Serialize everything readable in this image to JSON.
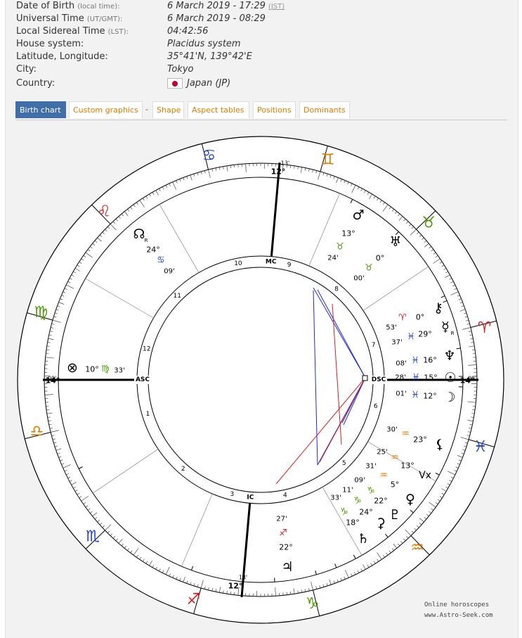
{
  "details": [
    {
      "label": "Date of Birth",
      "label_small": "(local time):",
      "value": "6 March 2019 - 17:29",
      "value_tz": "(JST)"
    },
    {
      "label": "Universal Time",
      "label_small": "(UT/GMT):",
      "value": "6 March 2019 - 08:29"
    },
    {
      "label": "Local Sidereal Time",
      "label_small": "(LST):",
      "value": "04:42:56"
    },
    {
      "label": "House system:",
      "value": "Placidus system"
    },
    {
      "label": "Latitude, Longitude:",
      "value": "35°41'N, 139°42'E"
    },
    {
      "label": "City:",
      "value": "Tokyo"
    },
    {
      "label": "Country:",
      "value": "Japan (JP)",
      "flag": "japan-flag"
    }
  ],
  "tabs": [
    {
      "label": "Birth chart",
      "active": true
    },
    {
      "label": "Custom graphics"
    },
    {
      "label": "Shape"
    },
    {
      "label": "Aspect tables"
    },
    {
      "label": "Positions"
    },
    {
      "label": "Dominants"
    }
  ],
  "tab_separator": "-",
  "chart": {
    "zodiac_signs": [
      {
        "glyph": "♊",
        "name": "gemini",
        "color": "#e07b00"
      },
      {
        "glyph": "♉",
        "name": "taurus",
        "color": "#4e9a06"
      },
      {
        "glyph": "♈",
        "name": "aries",
        "color": "#d61f1f"
      },
      {
        "glyph": "♓",
        "name": "pisces",
        "color": "#1f3fd6"
      },
      {
        "glyph": "♒",
        "name": "aquarius",
        "color": "#e07b00"
      },
      {
        "glyph": "♑",
        "name": "capricorn",
        "color": "#4e9a06"
      },
      {
        "glyph": "♐",
        "name": "sagittarius",
        "color": "#d61f1f"
      },
      {
        "glyph": "♏",
        "name": "scorpio",
        "color": "#1f3fd6"
      },
      {
        "glyph": "♎",
        "name": "libra",
        "color": "#e07b00"
      },
      {
        "glyph": "♍",
        "name": "virgo",
        "color": "#4e9a06"
      },
      {
        "glyph": "♌",
        "name": "leo",
        "color": "#d61f1f"
      },
      {
        "glyph": "♋",
        "name": "cancer",
        "color": "#1f3fd6"
      }
    ],
    "angles": {
      "asc": {
        "label": "ASC",
        "degree": "14°",
        "minute": "00'"
      },
      "dsc": {
        "label": "DSC",
        "degree": "14°",
        "minute": "00'"
      },
      "mc": {
        "label": "MC",
        "degree": "12°",
        "minute": "13'"
      },
      "ic": {
        "label": "IC",
        "degree": "12°",
        "minute": "13'"
      }
    },
    "house_numbers": [
      "1",
      "2",
      "3",
      "4",
      "5",
      "6",
      "7",
      "8",
      "9",
      "10",
      "11",
      "12"
    ],
    "planets": [
      {
        "name": "mars",
        "glyph": "♂",
        "degree": "13°",
        "sign_glyph": "♉",
        "sign_color": "#4e9a06",
        "minute": "24'"
      },
      {
        "name": "uranus",
        "glyph": "♅",
        "degree": "0°",
        "sign_glyph": "♉",
        "sign_color": "#4e9a06",
        "minute": "00'"
      },
      {
        "name": "chiron",
        "glyph": "⚷",
        "degree": "0°",
        "sign_glyph": "♈",
        "sign_color": "#d61f1f",
        "minute": "53'"
      },
      {
        "name": "mercury",
        "glyph": "☿",
        "retro": "R",
        "degree": "29°",
        "sign_glyph": "♓",
        "sign_color": "#1f3fd6",
        "minute": "37'"
      },
      {
        "name": "neptune",
        "glyph": "♆",
        "degree": "16°",
        "sign_glyph": "♓",
        "sign_color": "#1f3fd6",
        "minute": "08'"
      },
      {
        "name": "sun",
        "glyph": "☉",
        "degree": "15°",
        "sign_glyph": "♓",
        "sign_color": "#1f3fd6",
        "minute": "28'"
      },
      {
        "name": "moon",
        "glyph": "☽",
        "degree": "12°",
        "sign_glyph": "♓",
        "sign_color": "#1f3fd6",
        "minute": "01'"
      },
      {
        "name": "lilith",
        "glyph": "⚸",
        "degree": "23°",
        "sign_glyph": "♒",
        "sign_color": "#e07b00",
        "minute": "30'"
      },
      {
        "name": "vertex",
        "glyph": "Vx",
        "degree": "13°",
        "sign_glyph": "♒",
        "sign_color": "#e07b00",
        "minute": "25'"
      },
      {
        "name": "venus",
        "glyph": "♀",
        "degree": "5°",
        "sign_glyph": "♒",
        "sign_color": "#e07b00",
        "minute": "31'"
      },
      {
        "name": "pluto",
        "glyph": "♇",
        "degree": "22°",
        "sign_glyph": "♑",
        "sign_color": "#4e9a06",
        "minute": "09'"
      },
      {
        "name": "saturn",
        "glyph": "♄",
        "degree": "18°",
        "sign_glyph": "♑",
        "sign_color": "#4e9a06",
        "minute": "33'"
      },
      {
        "name": "ceres",
        "glyph": "⚳",
        "degree": "24°",
        "sign_glyph": "♑",
        "sign_color": "#4e9a06",
        "minute": "11'"
      },
      {
        "name": "jupiter",
        "glyph": "♃",
        "degree": "22°",
        "sign_glyph": "♐",
        "sign_color": "#d61f1f",
        "minute": "27'"
      },
      {
        "name": "fortune",
        "glyph": "⊗",
        "degree": "10°",
        "sign_glyph": "♍",
        "sign_color": "#4e9a06",
        "minute": "33'"
      },
      {
        "name": "node",
        "glyph": "☊",
        "retro": "R",
        "degree": "24°",
        "sign_glyph": "♋",
        "sign_color": "#1f3fd6",
        "minute": "09'"
      }
    ],
    "aspect_colors": {
      "trine": "#1f2bd6",
      "square": "#d61f1f"
    }
  },
  "credit": [
    "Online horoscopes",
    "www.Astro-Seek.com"
  ]
}
